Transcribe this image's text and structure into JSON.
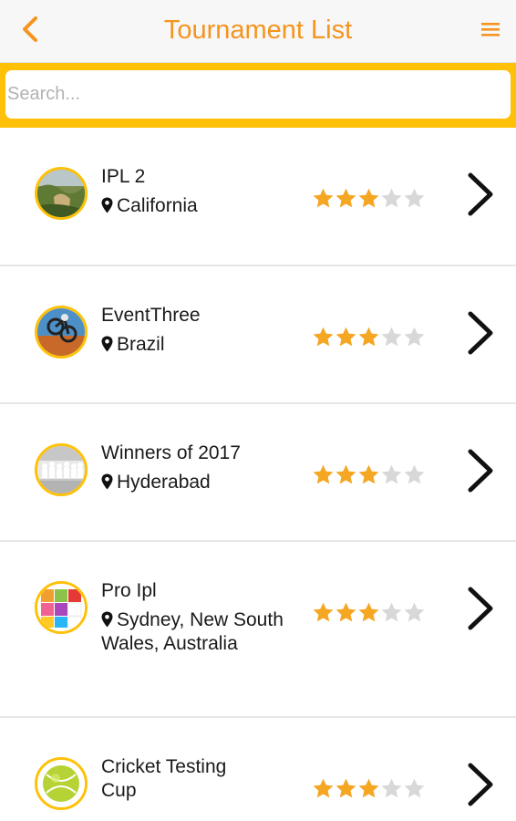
{
  "header": {
    "title": "Tournament List",
    "back_icon": "chevron-left-icon",
    "menu_icon": "hamburger-menu-icon",
    "accent_color": "#f5941f"
  },
  "search": {
    "placeholder": "Search...",
    "value": "",
    "bar_color": "#ffc107"
  },
  "tournaments": [
    {
      "name": "IPL 2",
      "location": "California",
      "rating": 3,
      "max_rating": 5,
      "avatar": "landscape-photo"
    },
    {
      "name": "EventThree",
      "location": "Brazil",
      "rating": 3,
      "max_rating": 5,
      "avatar": "bike-photo"
    },
    {
      "name": "Winners of 2017",
      "location": "Hyderabad",
      "rating": 3,
      "max_rating": 5,
      "avatar": "team-photo"
    },
    {
      "name": "Pro Ipl",
      "location": "Sydney, New South Wales, Australia",
      "rating": 3,
      "max_rating": 5,
      "avatar": "colorful-tiles"
    },
    {
      "name": "Cricket Testing Cup",
      "location": "",
      "rating": 3,
      "max_rating": 5,
      "avatar": "ball-icon"
    }
  ],
  "colors": {
    "star_filled": "#f5a623",
    "star_empty": "#d8d8d8",
    "avatar_ring": "#ffc107"
  }
}
